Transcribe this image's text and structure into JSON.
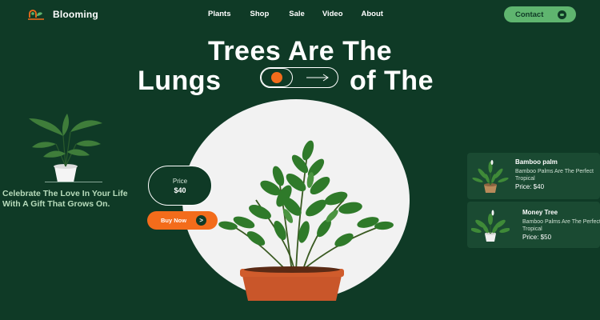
{
  "brand": {
    "name": "Blooming"
  },
  "nav": {
    "items": [
      "Plants",
      "Shop",
      "Sale",
      "Video",
      "About"
    ]
  },
  "header": {
    "contact_label": "Contact"
  },
  "hero": {
    "line1": "Trees Are The",
    "line2_left": "Lungs",
    "line2_right": "of The",
    "price_label": "Price",
    "price_value": "$40",
    "buy_label": "Buy Now",
    "buy_icon": ">"
  },
  "promo": {
    "text": "Celebrate The Love In Your Life With A Gift That Grows On."
  },
  "products": [
    {
      "name": "Bamboo palm",
      "description": "Bamboo Palms Are The Perfect Tropical",
      "price": "Price: $40"
    },
    {
      "name": "Money Tree",
      "description": "Bamboo Palms Are The Perfect Tropical",
      "price": "Price: $50"
    }
  ],
  "colors": {
    "background": "#0f3a26",
    "accent_green": "#5fb56f",
    "accent_orange": "#f36c1b",
    "card_bg": "#1a4a32",
    "promo_text": "#b7dbbb"
  },
  "icons": [
    "logo-icon",
    "arrow-right-icon",
    "chevron-right-icon",
    "contact-dot-icon"
  ]
}
